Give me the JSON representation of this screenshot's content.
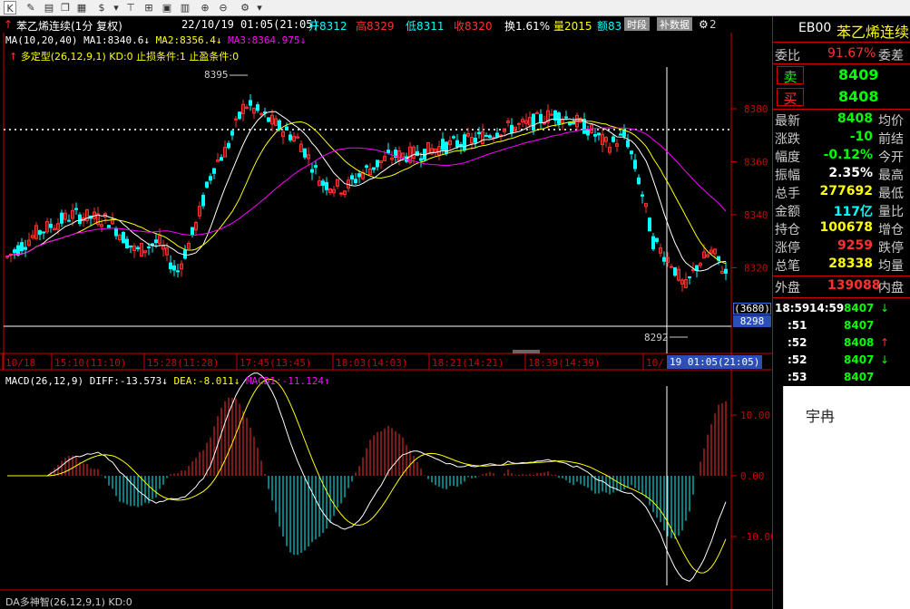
{
  "toolbar": {
    "buttons": [
      "K",
      "$",
      "edit-icon",
      "document-icon",
      "copy-icon",
      "dollar-icon",
      "filter-icon",
      "chart-icon",
      "zoom-in-icon",
      "zoom-out-icon",
      "settings-icon"
    ],
    "k_label": "K",
    "dollar_label": "$"
  },
  "info": {
    "name": "苯乙烯连续(1分 复权)",
    "datetime": "22/10/19 01:05(21:05)",
    "open_label": "开8312",
    "high_label": "高8329",
    "low_label": "低8311",
    "close_label": "收8320",
    "turnover_label": "换1.61%",
    "volume_label": "量2015",
    "amount_label": "额83",
    "btn_period": "时段",
    "btn_data": "补数据",
    "trailing": "2"
  },
  "indicators": {
    "ma_line": {
      "label": "MA(10,20,40)",
      "ma1": "MA1:8340.6",
      "ma2": "MA2:8356.4",
      "ma3": "MA3:8364.975"
    },
    "strategy": "多定型(26,12,9,1) KD:0 止损条件:1 止盈条件:0",
    "macd": {
      "label": "MACD(26,12,9)",
      "diff": "DIFF:-13.573",
      "dea": "DEA:-8.011",
      "macd1": "MACD1:-11.124"
    },
    "da": "DA多神智(26,12,9,1) KD:0"
  },
  "axis": {
    "price_ticks": [
      "8380",
      "8360",
      "8340",
      "8320"
    ],
    "macd_ticks": [
      "10.00",
      "0.00",
      "-10.00"
    ],
    "time_labels": [
      "10/18",
      "15:10(11:10)",
      "15:28(11:28)",
      "17:45(13:45)",
      "18:03(14:03)",
      "18:21(14:21)",
      "18:39(14:39)",
      "10/"
    ],
    "cursor_time": "19 01:05(21:05)",
    "high_mark": "8395",
    "low_mark": "8292",
    "cursor_badge": "(3680)",
    "cursor_price": "8298"
  },
  "quote": {
    "code": "EB00",
    "name": "苯乙烯连续",
    "webi_label": "委比",
    "webi_value": "91.67%",
    "weicha_label": "委差",
    "sell_label": "卖",
    "sell_value": "8409",
    "buy_label": "买",
    "buy_value": "8408",
    "rows": [
      {
        "label": "最新",
        "value": "8408",
        "right": "均价",
        "color": "#00ff00"
      },
      {
        "label": "涨跌",
        "value": "-10",
        "right": "前结",
        "color": "#00ff00"
      },
      {
        "label": "幅度",
        "value": "-0.12%",
        "right": "今开",
        "color": "#00ff00"
      },
      {
        "label": "振幅",
        "value": "2.35%",
        "right": "最高",
        "color": "#ffffff"
      },
      {
        "label": "总手",
        "value": "277692",
        "right": "最低",
        "color": "#ffff00"
      },
      {
        "label": "金额",
        "value": "117亿",
        "right": "量比",
        "color": "#00ffff"
      },
      {
        "label": "持仓",
        "value": "100678",
        "right": "增仓",
        "color": "#ffff00"
      },
      {
        "label": "涨停",
        "value": "9259",
        "right": "跌停",
        "color": "#ff3030"
      },
      {
        "label": "总笔",
        "value": "28338",
        "right": "均量",
        "color": "#ffff00"
      }
    ],
    "outer_label": "外盘",
    "outer_value": "139088",
    "inner_label": "内盘",
    "ticks": [
      {
        "time": "18:59",
        "time2": "14:59",
        "price": "8407",
        "arrow": "↓",
        "arrow_color": "#00ff00"
      },
      {
        "time": ":51",
        "time2": "",
        "price": "8407",
        "arrow": "",
        "arrow_color": "#00ff00"
      },
      {
        "time": ":52",
        "time2": "",
        "price": "8408",
        "arrow": "↑",
        "arrow_color": "#ff3030"
      },
      {
        "time": ":52",
        "time2": "",
        "price": "8407",
        "arrow": "↓",
        "arrow_color": "#00ff00"
      },
      {
        "time": ":53",
        "time2": "",
        "price": "8407",
        "arrow": "",
        "arrow_color": "#00ff00"
      }
    ]
  },
  "popup": {
    "name": "宇冉"
  },
  "colors": {
    "up": "#ff3030",
    "down": "#00ffff",
    "ma1": "#ffffff",
    "ma2": "#ffff00",
    "ma3": "#ff00ff"
  }
}
